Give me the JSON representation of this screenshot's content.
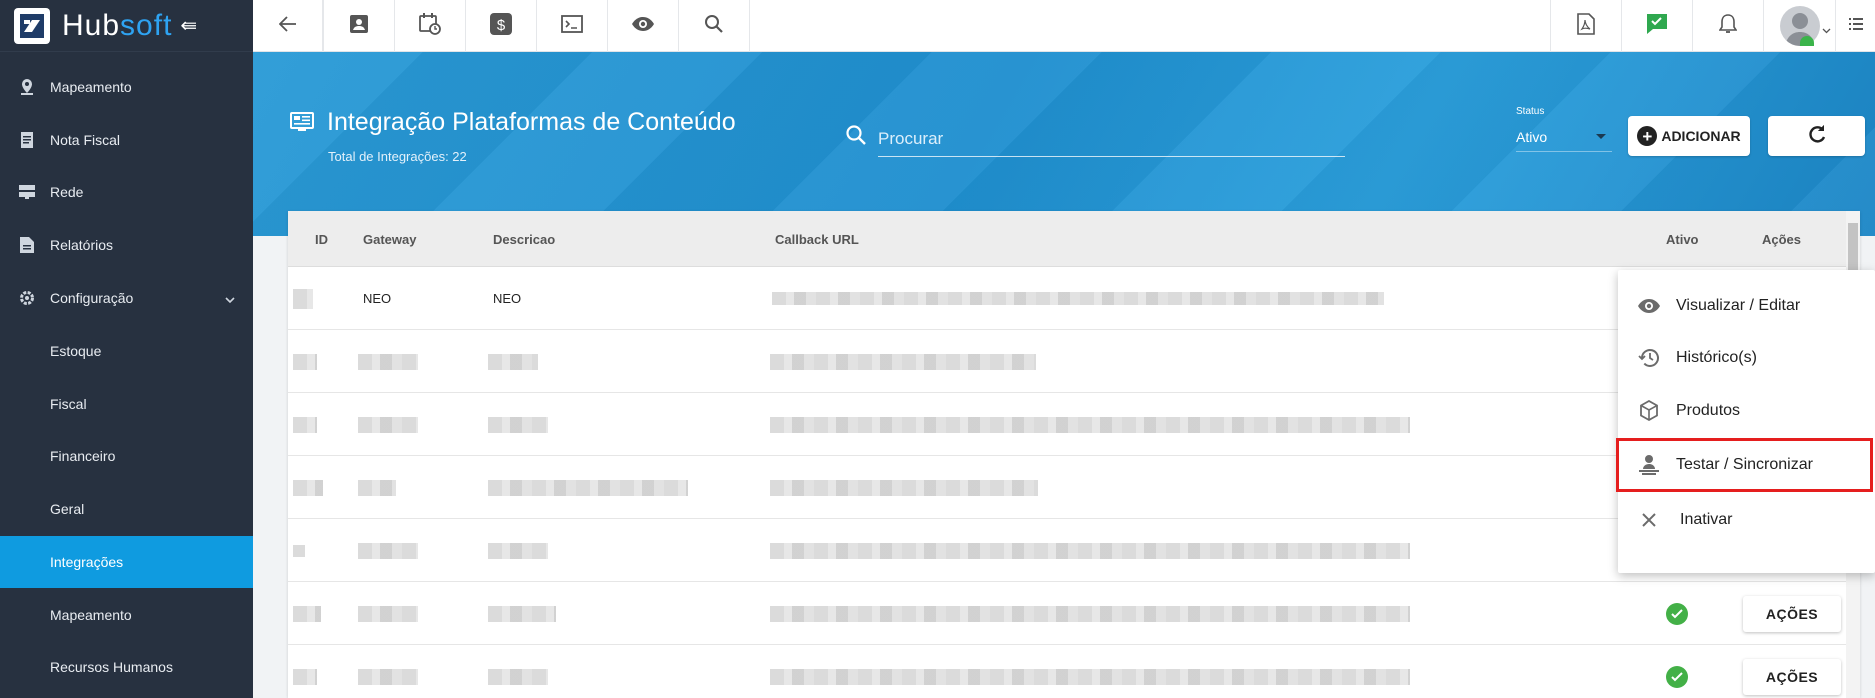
{
  "brand": {
    "name_main": "Hub",
    "name_accent": "soft"
  },
  "sidebar": {
    "items": [
      {
        "label": "Mapeamento",
        "icon": "map-pin-icon"
      },
      {
        "label": "Nota Fiscal",
        "icon": "receipt-icon"
      },
      {
        "label": "Rede",
        "icon": "server-icon"
      },
      {
        "label": "Relatórios",
        "icon": "report-icon"
      },
      {
        "label": "Configuração",
        "icon": "gear-icon",
        "expanded": true
      }
    ],
    "subitems": [
      {
        "label": "Estoque"
      },
      {
        "label": "Fiscal"
      },
      {
        "label": "Financeiro"
      },
      {
        "label": "Geral"
      },
      {
        "label": "Integrações",
        "active": true
      },
      {
        "label": "Mapeamento"
      },
      {
        "label": "Recursos Humanos"
      }
    ]
  },
  "topbar": {
    "left_icons": [
      "back-arrow-icon",
      "contact-card-icon",
      "calendar-clock-icon",
      "dollar-icon",
      "terminal-icon",
      "eye-icon",
      "search-icon"
    ],
    "right_icons": [
      "pdf-icon",
      "chat-check-icon",
      "bell-icon",
      "user-avatar-icon",
      "list-icon"
    ]
  },
  "header": {
    "title": "Integração Plataformas de Conteúdo",
    "subtitle": "Total de Integrações: 22",
    "search_placeholder": "Procurar",
    "status_label": "Status",
    "status_value": "Ativo",
    "add_label": "ADICIONAR"
  },
  "table": {
    "columns": [
      "ID",
      "Gateway",
      "Descricao",
      "Callback URL",
      "Ativo",
      "Ações"
    ],
    "first_row": {
      "gateway": "NEO",
      "descricao": "NEO"
    },
    "action_label": "AÇÕES"
  },
  "menu": {
    "items": [
      {
        "label": "Visualizar / Editar",
        "icon": "eye-icon"
      },
      {
        "label": "Histórico(s)",
        "icon": "history-icon"
      },
      {
        "label": "Produtos",
        "icon": "box-icon"
      },
      {
        "label": "Testar / Sincronizar",
        "icon": "sync-person-icon",
        "highlighted": true
      },
      {
        "label": "Inativar",
        "icon": "close-icon"
      }
    ]
  },
  "colors": {
    "sidebar": "#273140",
    "active": "#0f9be0",
    "band": "#2a9ad6",
    "ok": "#43b047",
    "highlight": "#e51e1e"
  }
}
